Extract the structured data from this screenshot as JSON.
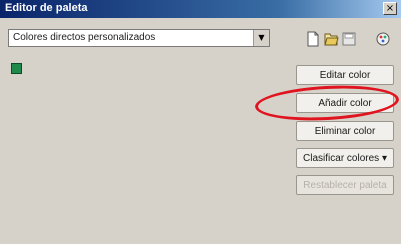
{
  "window": {
    "title": "Editor de paleta",
    "close_glyph": "×"
  },
  "palette_select": {
    "value": "Colores directos personalizados",
    "arrow_glyph": "▼"
  },
  "toolbar": {
    "icons": [
      "new-palette-icon",
      "open-palette-icon",
      "save-palette-icon",
      "palette-properties-icon"
    ]
  },
  "swatches": [
    {
      "color": "#1f8a4c"
    }
  ],
  "buttons": {
    "edit_color": "Editar color",
    "add_color": "Añadir color",
    "delete_color": "Eliminar color",
    "sort_colors": "Clasificar colores ▾",
    "reset_palette": "Restablecer paleta"
  },
  "colors": {
    "titlebar_start": "#0a246a",
    "window_bg": "#d6d2ca",
    "highlight": "#e0141e"
  }
}
